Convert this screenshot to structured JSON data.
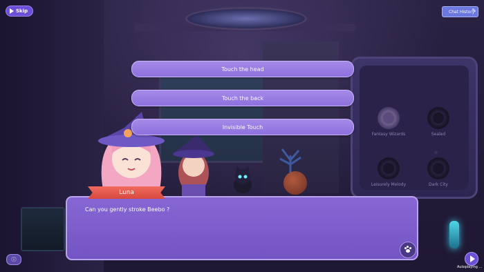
{
  "top_bar": {
    "skip_label": "Skip",
    "chat_history_label": "Chat History"
  },
  "choices": [
    {
      "label": "Touch the head"
    },
    {
      "label": "Touch the back"
    },
    {
      "label": "Invisible Touch"
    }
  ],
  "dialog": {
    "speaker": "Luna",
    "text": "Can you gently stroke Beebo ?"
  },
  "collection_panel": {
    "items": [
      {
        "label": "Fantasy Wizards",
        "active": true
      },
      {
        "label": "Sealed",
        "active": false
      },
      {
        "label": "Leisurely Melody",
        "active": false
      },
      {
        "label": "Dark City",
        "active": false
      }
    ]
  },
  "bottom_bar": {
    "auto_label": "Autoplaying ..."
  },
  "icons": {
    "skip": "play-forward-icon",
    "chat_history": "pen-icon",
    "paw": "paw-icon",
    "info": "info-icon",
    "autoplay": "play-icon"
  },
  "colors": {
    "choice_bg": "#9a7de3",
    "dialog_bg": "#7e5ecb",
    "name_banner": "#e35a4e",
    "skip_bg": "#6c4fd8",
    "chat_history_bg": "#6a78e0"
  }
}
